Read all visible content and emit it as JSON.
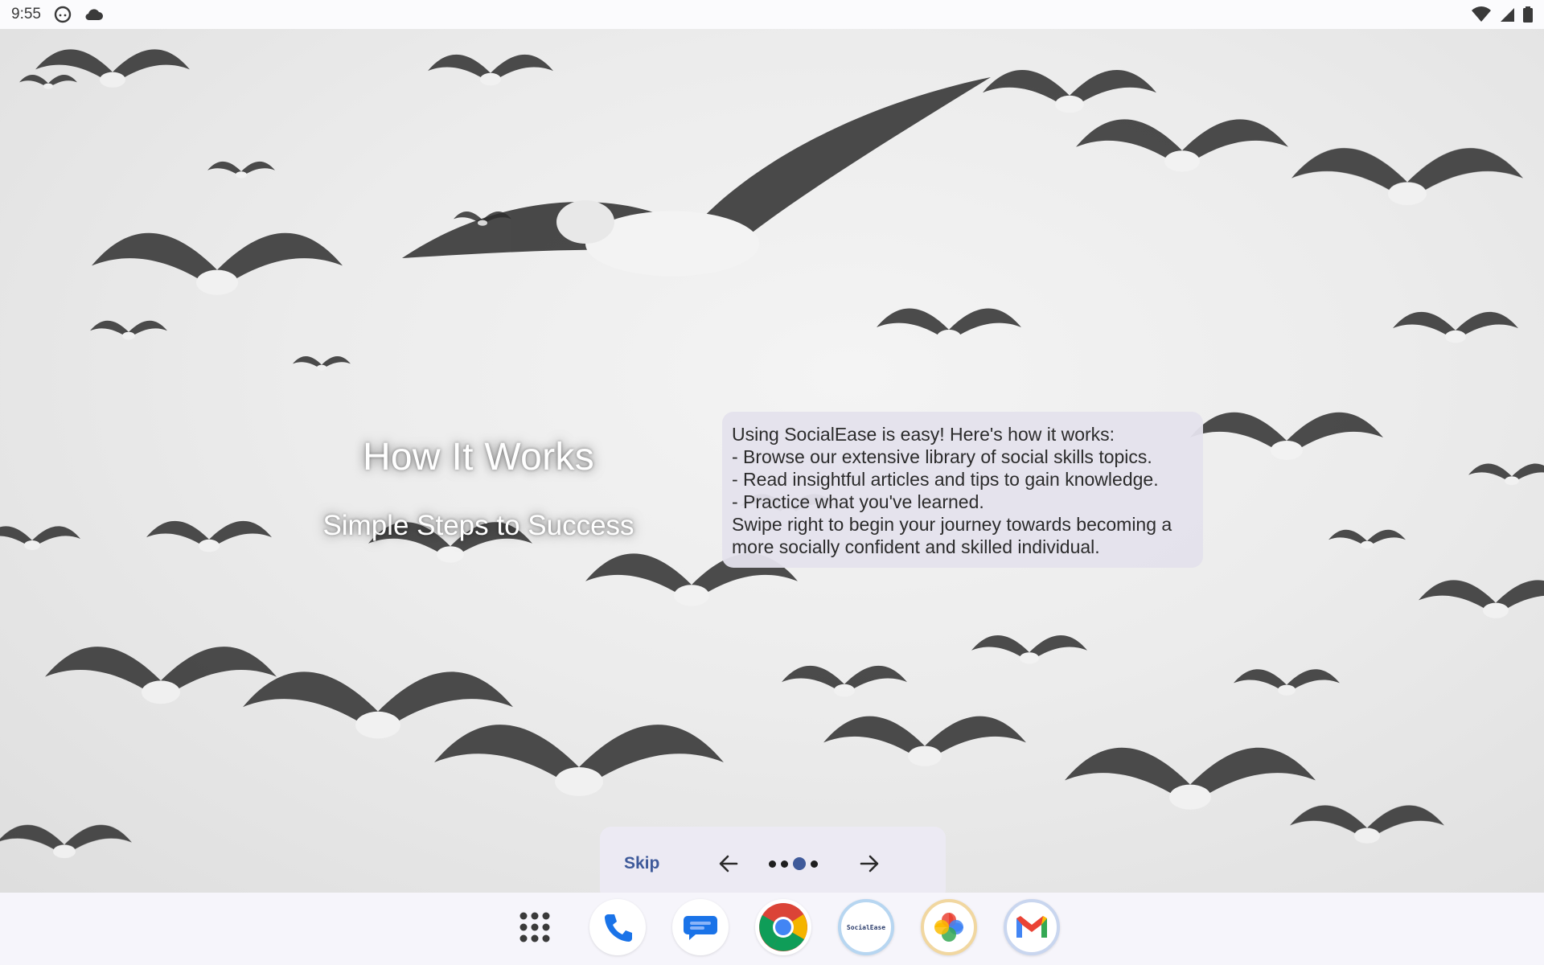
{
  "status_bar": {
    "time": "9:55",
    "left_icons": [
      "android-icon",
      "cloud-icon"
    ],
    "right_icons": [
      "wifi-icon",
      "signal-icon",
      "battery-icon"
    ]
  },
  "onboarding": {
    "title": "How It Works",
    "subtitle": "Simple Steps to Success",
    "description_lines": [
      "Using SocialEase is easy! Here's how it works:",
      "- Browse our extensive library of social skills topics.",
      "- Read insightful articles and tips to gain knowledge.",
      "- Practice what you've learned.",
      "Swipe right to begin your journey towards becoming a",
      "more socially confident and skilled individual."
    ],
    "navigation": {
      "skip_label": "Skip",
      "page_count": 4,
      "current_page": 3
    }
  },
  "dock": {
    "apps": [
      {
        "name": "app-drawer",
        "icon": "grid-icon"
      },
      {
        "name": "phone",
        "icon": "phone-icon"
      },
      {
        "name": "messages",
        "icon": "messages-icon"
      },
      {
        "name": "chrome",
        "icon": "chrome-icon"
      },
      {
        "name": "socialease",
        "icon": "socialease-icon",
        "label": "SocialEase"
      },
      {
        "name": "photos",
        "icon": "photos-icon"
      },
      {
        "name": "gmail",
        "icon": "gmail-icon"
      }
    ]
  },
  "colors": {
    "accent": "#3f5a9a",
    "card_bg": "#e4e2ec",
    "dock_bg": "#f6f5fb"
  }
}
